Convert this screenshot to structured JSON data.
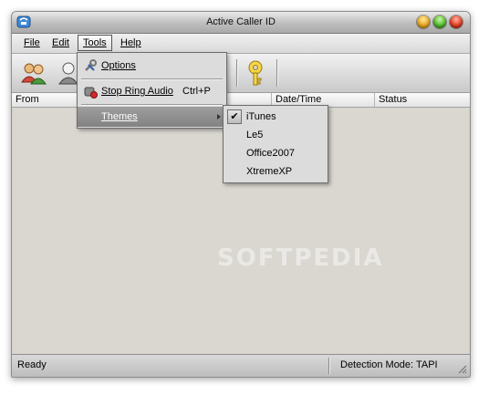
{
  "window": {
    "title": "Active Caller ID"
  },
  "menubar": {
    "file": "File",
    "edit": "Edit",
    "tools": "Tools",
    "help": "Help"
  },
  "tools_menu": {
    "options": "Options",
    "stop_ring_audio": "Stop Ring Audio",
    "stop_ring_audio_shortcut": "Ctrl+P",
    "themes": "Themes"
  },
  "themes_submenu": {
    "items": [
      {
        "label": "iTunes",
        "checked": true
      },
      {
        "label": "Le5",
        "checked": false
      },
      {
        "label": "Office2007",
        "checked": false
      },
      {
        "label": "XtremeXP",
        "checked": false
      }
    ]
  },
  "list": {
    "columns": [
      "From",
      "Date/Time",
      "Status"
    ]
  },
  "statusbar": {
    "left": "Ready",
    "right": "Detection Mode: TAPI"
  },
  "watermark": "SOFTPEDIA",
  "icons": {
    "app": "caller-id-app-icon",
    "contacts": "contacts-icon",
    "user": "user-icon",
    "key": "key-icon",
    "options": "wrench-screwdriver-icon",
    "stop_audio": "phone-stop-icon"
  },
  "colors": {
    "highlight": "#8c8c8c",
    "window_bg": "#d6d4cc"
  }
}
